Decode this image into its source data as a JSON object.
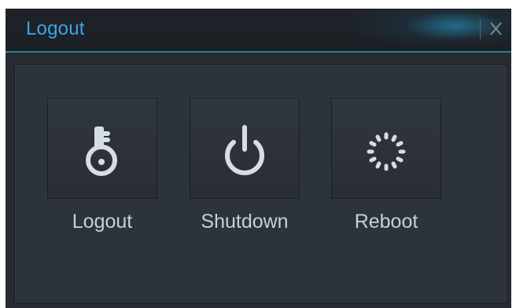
{
  "dialog": {
    "title": "Logout",
    "close_label": "X"
  },
  "actions": [
    {
      "label": "Logout",
      "icon": "key-icon"
    },
    {
      "label": "Shutdown",
      "icon": "power-icon"
    },
    {
      "label": "Reboot",
      "icon": "reboot-spinner-icon"
    }
  ],
  "colors": {
    "title": "#39a6e8",
    "icon": "#d6dde6",
    "label": "#c9cfd6",
    "accent_line": "#2a7f93"
  }
}
